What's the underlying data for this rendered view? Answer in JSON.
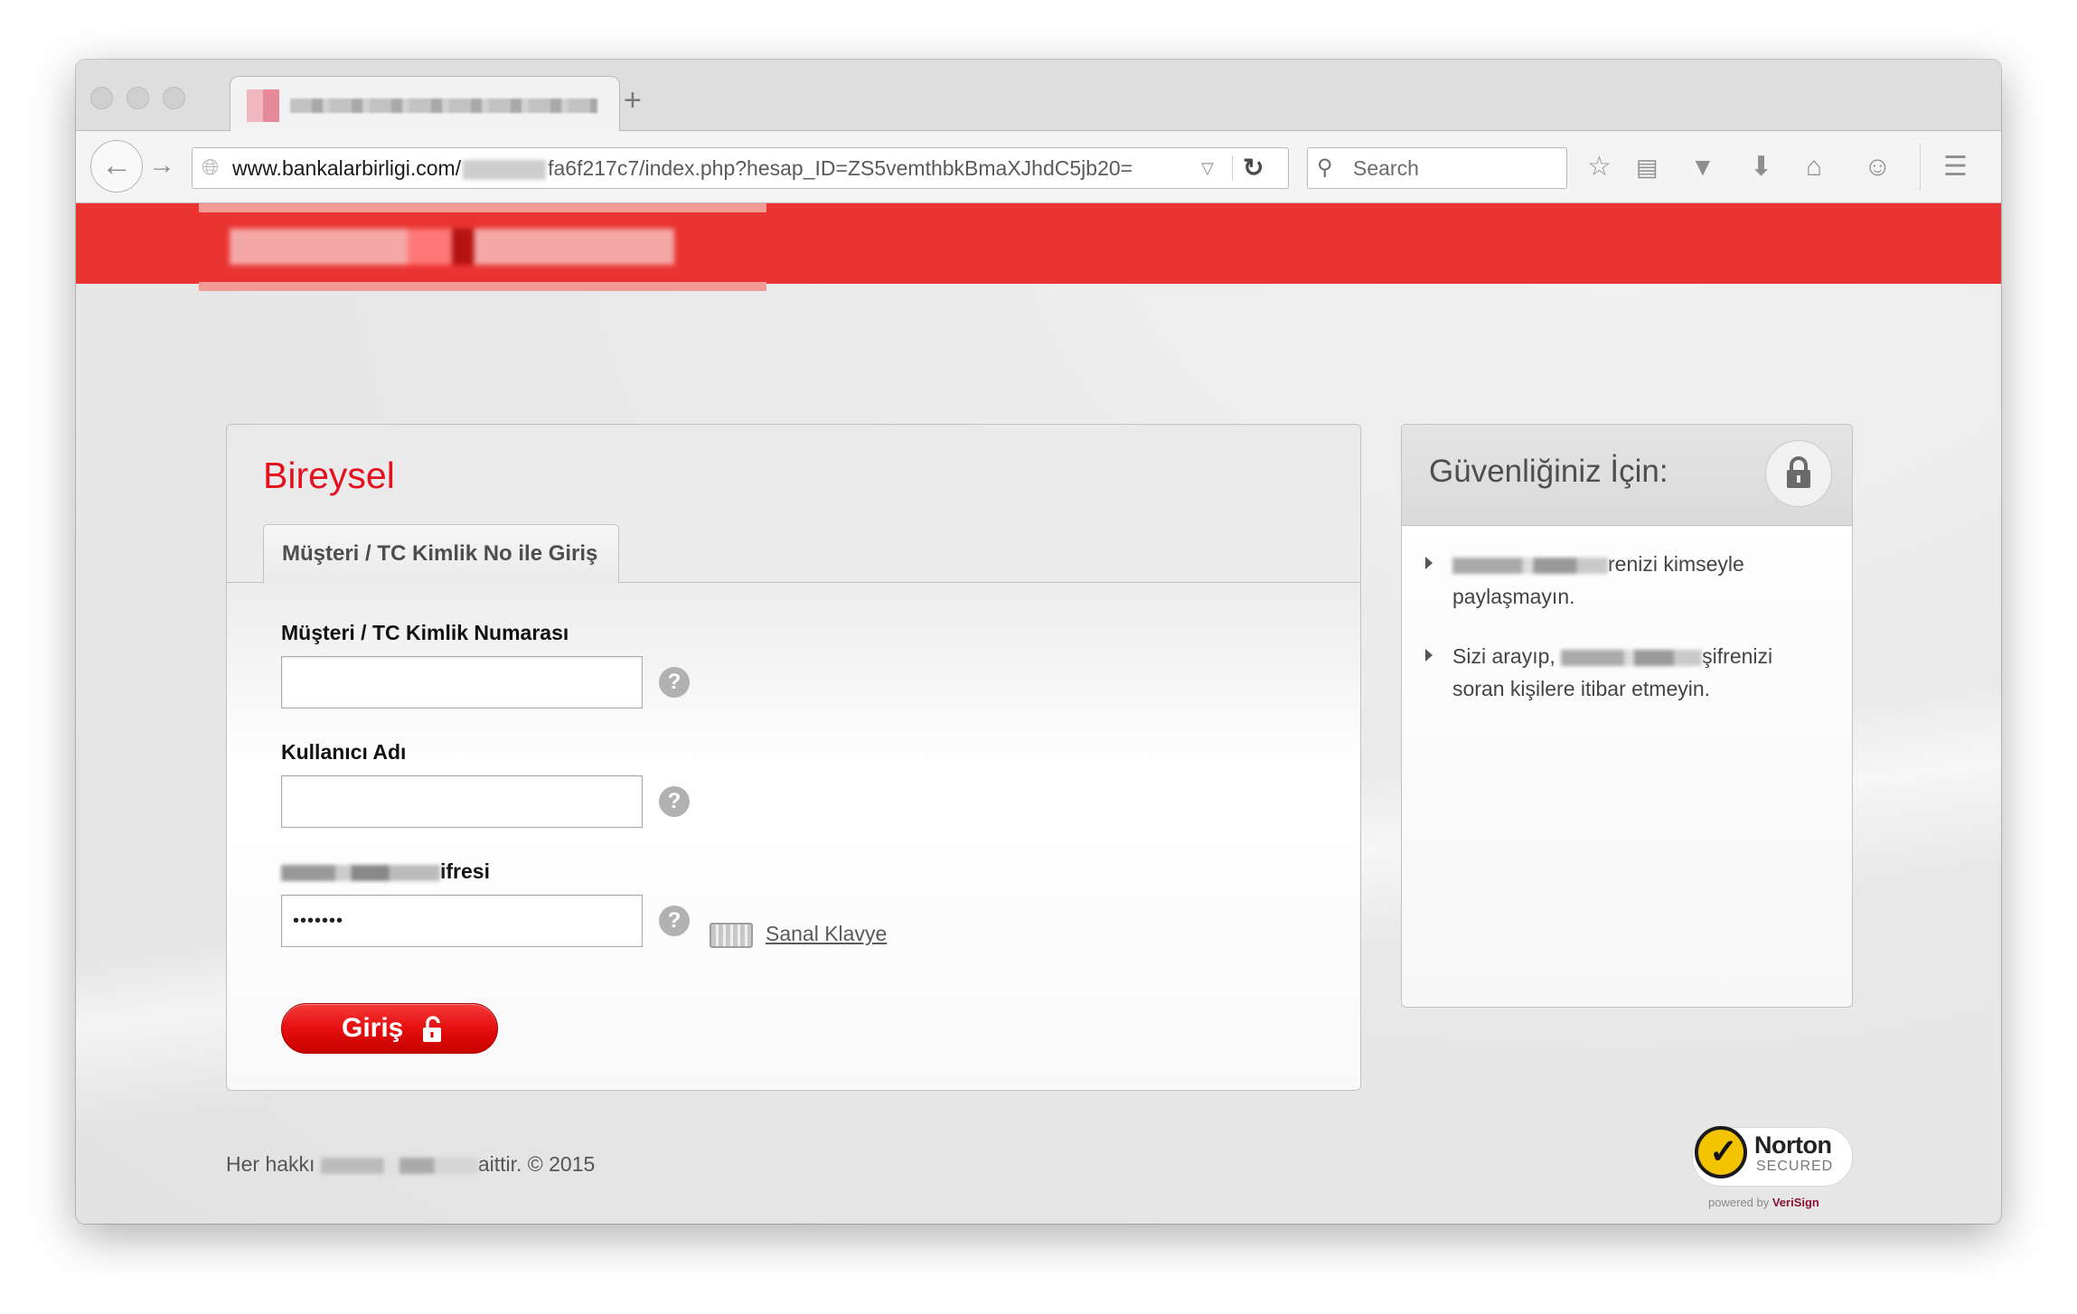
{
  "browser": {
    "tab_title": "",
    "new_tab": "+",
    "url_host": "www.bankalarbirligi.com/",
    "url_path": "fa6f217c7/index.php?hesap_ID=ZS5vemthbkBmaXJhdC5jb20=",
    "search_placeholder": "Search",
    "icons": [
      "back-arrow-icon",
      "forward-arrow-icon",
      "globe-icon",
      "dropdown-icon",
      "reload-icon",
      "search-icon",
      "bookmark-star-icon",
      "reading-list-icon",
      "pocket-icon",
      "download-icon",
      "home-icon",
      "chat-icon",
      "menu-icon"
    ]
  },
  "page": {
    "panel_title": "Bireysel",
    "login_tab": "Müşteri / TC Kimlik No ile Giriş",
    "fields": {
      "customer_id_label": "Müşteri / TC Kimlik Numarası",
      "customer_id_value": "",
      "username_label": "Kullanıcı Adı",
      "username_value": "",
      "password_label_suffix": "ifresi",
      "password_value": "•••••••"
    },
    "help_glyph": "?",
    "virtual_keyboard": "Sanal Klavye",
    "login_button": "Giriş",
    "security": {
      "title": "Güvenliğiniz İçin:",
      "tip1_suffix": "renizi kimseyle",
      "tip1_line2": "paylaşmayın.",
      "tip2_prefix": "Sizi arayıp,",
      "tip2_suffix": "şifrenizi",
      "tip2_line2": "soran kişilere itibar etmeyin."
    },
    "footer_prefix": "Her hakkı",
    "footer_suffix": "aittir. © 2015",
    "norton": {
      "name": "Norton",
      "sub": "SECURED",
      "powered": "powered by",
      "verisign": "VeriSign"
    }
  },
  "colors": {
    "brand_red": "#ea3431",
    "title_red": "#e5101d",
    "button_red": "#e60f0f",
    "norton_yellow": "#f4c300"
  }
}
